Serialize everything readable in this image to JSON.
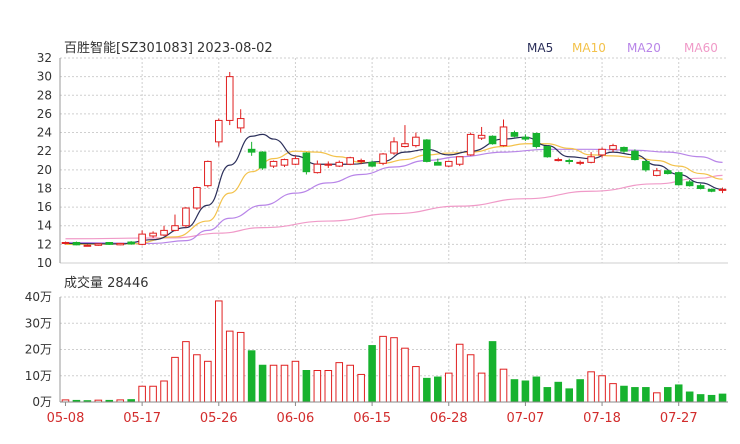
{
  "header": {
    "title": "百胜智能[SZ301083] 2023-08-02",
    "legend": [
      {
        "label": "MA5",
        "color": "#2b2f5a"
      },
      {
        "label": "MA10",
        "color": "#f3c24b"
      },
      {
        "label": "MA20",
        "color": "#b885e8"
      },
      {
        "label": "MA60",
        "color": "#f09ac8"
      }
    ]
  },
  "volume_label": "成交量 28446",
  "colors": {
    "up": "#e02020",
    "down": "#17b22e",
    "grid": "#cfcfcf",
    "axis_text": "#333333",
    "date_text": "#d22c2c"
  },
  "chart_data": [
    {
      "type": "candlestick",
      "title": "百胜智能[SZ301083] 2023-08-02",
      "ylim": [
        10,
        32
      ],
      "yticks": [
        "10",
        "12",
        "14",
        "16",
        "18",
        "20",
        "22",
        "24",
        "26",
        "28",
        "30",
        "32"
      ],
      "xticks": [
        {
          "label": "05-08",
          "index": 0
        },
        {
          "label": "05-17",
          "index": 7
        },
        {
          "label": "05-26",
          "index": 14
        },
        {
          "label": "06-06",
          "index": 21
        },
        {
          "label": "06-15",
          "index": 28
        },
        {
          "label": "06-28",
          "index": 35
        },
        {
          "label": "07-07",
          "index": 42
        },
        {
          "label": "07-18",
          "index": 49
        },
        {
          "label": "07-27",
          "index": 56
        }
      ],
      "ohlc": [
        [
          12.1,
          12.3,
          12.0,
          12.2
        ],
        [
          12.2,
          12.3,
          11.9,
          11.95
        ],
        [
          11.9,
          12.0,
          11.8,
          11.9
        ],
        [
          11.9,
          12.1,
          11.85,
          12.05
        ],
        [
          12.2,
          12.25,
          11.95,
          12.0
        ],
        [
          11.95,
          12.15,
          11.9,
          12.1
        ],
        [
          12.25,
          12.35,
          11.95,
          12.05
        ],
        [
          12.0,
          13.5,
          11.9,
          13.1
        ],
        [
          12.9,
          13.4,
          12.7,
          13.2
        ],
        [
          13.0,
          14.0,
          12.9,
          13.5
        ],
        [
          13.5,
          15.2,
          13.4,
          14.0
        ],
        [
          14.0,
          16.0,
          13.8,
          15.9
        ],
        [
          15.9,
          18.2,
          15.7,
          18.1
        ],
        [
          18.3,
          21.0,
          18.1,
          20.9
        ],
        [
          23.0,
          25.5,
          22.5,
          25.3
        ],
        [
          25.3,
          30.5,
          24.8,
          30.0
        ],
        [
          24.5,
          26.5,
          24.0,
          25.5
        ],
        [
          22.2,
          23.0,
          21.5,
          21.9
        ],
        [
          21.9,
          22.0,
          20.0,
          20.2
        ],
        [
          20.4,
          21.0,
          20.2,
          20.9
        ],
        [
          20.5,
          21.2,
          20.3,
          21.1
        ],
        [
          20.6,
          21.5,
          20.5,
          21.2
        ],
        [
          21.8,
          21.9,
          19.5,
          19.8
        ],
        [
          19.7,
          21.0,
          19.6,
          20.6
        ],
        [
          20.5,
          20.9,
          20.2,
          20.6
        ],
        [
          20.4,
          21.0,
          20.3,
          20.8
        ],
        [
          20.6,
          21.4,
          20.5,
          21.3
        ],
        [
          20.9,
          21.2,
          20.6,
          21.0
        ],
        [
          20.8,
          21.0,
          20.3,
          20.4
        ],
        [
          20.7,
          21.8,
          20.5,
          21.7
        ],
        [
          21.8,
          23.5,
          21.6,
          23.0
        ],
        [
          22.5,
          24.8,
          22.4,
          22.8
        ],
        [
          22.6,
          24.0,
          22.4,
          23.5
        ],
        [
          23.2,
          23.3,
          20.8,
          20.9
        ],
        [
          20.8,
          21.2,
          20.5,
          20.5
        ],
        [
          20.4,
          21.0,
          20.3,
          20.9
        ],
        [
          20.6,
          21.2,
          20.4,
          21.4
        ],
        [
          21.6,
          24.0,
          21.5,
          23.8
        ],
        [
          23.4,
          24.6,
          23.2,
          23.7
        ],
        [
          23.6,
          23.7,
          22.7,
          22.8
        ],
        [
          22.6,
          25.4,
          22.5,
          24.6
        ],
        [
          24.0,
          24.2,
          23.5,
          23.6
        ],
        [
          23.5,
          23.8,
          23.1,
          23.3
        ],
        [
          23.9,
          24.0,
          22.3,
          22.5
        ],
        [
          22.5,
          22.6,
          21.3,
          21.4
        ],
        [
          21.1,
          21.3,
          20.9,
          21.1
        ],
        [
          21.0,
          21.2,
          20.6,
          20.9
        ],
        [
          20.7,
          21.0,
          20.5,
          20.8
        ],
        [
          20.8,
          21.9,
          20.7,
          21.4
        ],
        [
          21.6,
          22.4,
          21.3,
          22.2
        ],
        [
          22.2,
          22.8,
          21.9,
          22.6
        ],
        [
          22.4,
          22.5,
          21.8,
          22.0
        ],
        [
          22.0,
          22.2,
          21.0,
          21.1
        ],
        [
          20.9,
          21.0,
          19.8,
          20.0
        ],
        [
          19.4,
          20.2,
          19.3,
          19.9
        ],
        [
          19.9,
          20.0,
          19.5,
          19.6
        ],
        [
          19.7,
          19.8,
          18.3,
          18.4
        ],
        [
          18.7,
          18.9,
          18.2,
          18.3
        ],
        [
          18.3,
          18.5,
          17.9,
          18.0
        ],
        [
          17.9,
          18.0,
          17.6,
          17.7
        ],
        [
          17.8,
          18.1,
          17.5,
          17.9
        ]
      ],
      "ma": {
        "MA5": [
          [
            0,
            12.1
          ],
          [
            5,
            12.05
          ],
          [
            8,
            12.5
          ],
          [
            11,
            13.8
          ],
          [
            13,
            16.2
          ],
          [
            15,
            20.5
          ],
          [
            17,
            23.6
          ],
          [
            18,
            23.8
          ],
          [
            19,
            23.3
          ],
          [
            21,
            21.5
          ],
          [
            23,
            20.6
          ],
          [
            26,
            20.6
          ],
          [
            29,
            20.9
          ],
          [
            31,
            21.9
          ],
          [
            33,
            22.2
          ],
          [
            35,
            21.6
          ],
          [
            37,
            22.0
          ],
          [
            40,
            23.3
          ],
          [
            42,
            23.5
          ],
          [
            44,
            22.6
          ],
          [
            46,
            21.4
          ],
          [
            48,
            21.2
          ],
          [
            50,
            21.9
          ],
          [
            52,
            21.6
          ],
          [
            54,
            20.5
          ],
          [
            56,
            19.5
          ],
          [
            58,
            18.6
          ],
          [
            60,
            17.9
          ]
        ],
        "MA10": [
          [
            0,
            12.0
          ],
          [
            6,
            12.05
          ],
          [
            10,
            12.8
          ],
          [
            13,
            14.5
          ],
          [
            15,
            17.5
          ],
          [
            17,
            19.8
          ],
          [
            19,
            21.2
          ],
          [
            21,
            22.0
          ],
          [
            23,
            21.9
          ],
          [
            25,
            21.4
          ],
          [
            27,
            20.8
          ],
          [
            29,
            20.7
          ],
          [
            31,
            21.1
          ],
          [
            33,
            21.6
          ],
          [
            35,
            21.8
          ],
          [
            37,
            21.9
          ],
          [
            40,
            22.5
          ],
          [
            42,
            22.8
          ],
          [
            44,
            22.8
          ],
          [
            46,
            22.3
          ],
          [
            48,
            21.6
          ],
          [
            50,
            21.5
          ],
          [
            52,
            21.3
          ],
          [
            54,
            21.0
          ],
          [
            56,
            20.4
          ],
          [
            58,
            19.6
          ],
          [
            60,
            19.0
          ]
        ],
        "MA20": [
          [
            0,
            12.2
          ],
          [
            8,
            12.1
          ],
          [
            11,
            12.4
          ],
          [
            13,
            13.5
          ],
          [
            15,
            14.8
          ],
          [
            18,
            16.2
          ],
          [
            21,
            17.5
          ],
          [
            24,
            18.6
          ],
          [
            27,
            19.5
          ],
          [
            30,
            20.3
          ],
          [
            33,
            21.0
          ],
          [
            36,
            21.4
          ],
          [
            40,
            21.9
          ],
          [
            44,
            22.2
          ],
          [
            48,
            22.2
          ],
          [
            52,
            22.1
          ],
          [
            55,
            21.9
          ],
          [
            58,
            21.4
          ],
          [
            60,
            20.8
          ]
        ],
        "MA60": [
          [
            0,
            12.6
          ],
          [
            10,
            12.7
          ],
          [
            14,
            13.2
          ],
          [
            18,
            13.8
          ],
          [
            24,
            14.5
          ],
          [
            30,
            15.3
          ],
          [
            36,
            16.1
          ],
          [
            42,
            16.9
          ],
          [
            48,
            17.7
          ],
          [
            54,
            18.5
          ],
          [
            58,
            19.1
          ],
          [
            60,
            19.4
          ]
        ]
      }
    },
    {
      "type": "bar",
      "title": "成交量 28446",
      "ylim": [
        0,
        40
      ],
      "yticks": [
        "0万",
        "10万",
        "20万",
        "30万",
        "40万"
      ],
      "values": [
        0.8,
        0.6,
        0.5,
        0.7,
        0.6,
        0.8,
        0.9,
        6.0,
        6.0,
        8.0,
        17.0,
        23.0,
        18.0,
        15.5,
        38.5,
        27.0,
        26.5,
        19.5,
        14.0,
        14.0,
        14.0,
        15.5,
        12.0,
        12.0,
        12.0,
        15.0,
        14.0,
        10.5,
        21.5,
        25.0,
        24.5,
        20.5,
        13.5,
        9.0,
        9.5,
        11.0,
        22.0,
        18.0,
        11.0,
        23.0,
        12.5,
        8.5,
        8.0,
        9.5,
        5.5,
        7.5,
        5.0,
        8.5,
        11.5,
        10.0,
        7.0,
        6.0,
        5.5,
        5.5,
        3.5,
        5.5,
        6.5,
        3.8,
        2.8,
        2.5,
        3.0
      ],
      "up": [
        1,
        0,
        0,
        1,
        0,
        1,
        0,
        1,
        1,
        1,
        1,
        1,
        1,
        1,
        1,
        1,
        1,
        0,
        0,
        1,
        1,
        1,
        0,
        1,
        1,
        1,
        1,
        1,
        0,
        1,
        1,
        1,
        1,
        0,
        0,
        1,
        1,
        1,
        1,
        0,
        1,
        0,
        0,
        0,
        0,
        0,
        0,
        0,
        1,
        1,
        1,
        0,
        0,
        0,
        1,
        0,
        0,
        0,
        0,
        0,
        0
      ]
    }
  ]
}
